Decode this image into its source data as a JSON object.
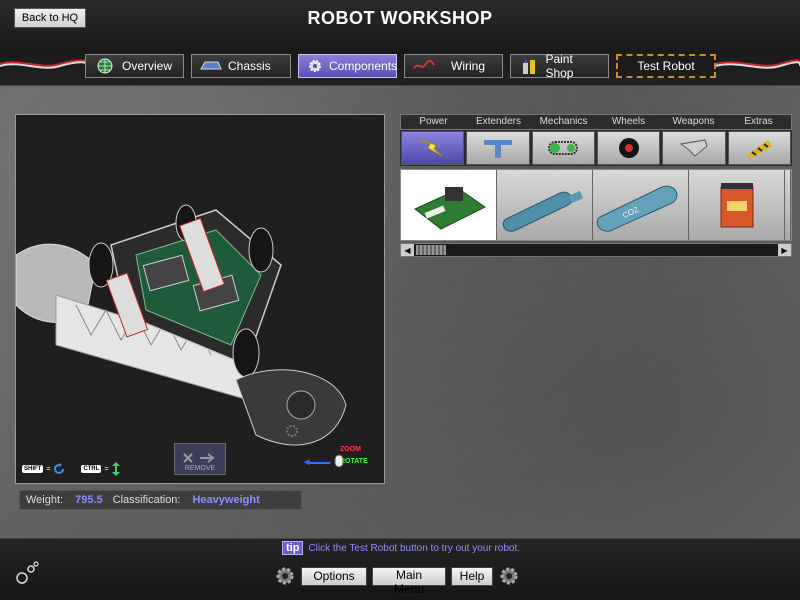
{
  "header": {
    "back_label": "Back to HQ",
    "title": "ROBOT WORKSHOP"
  },
  "tabs": [
    {
      "label": "Overview",
      "icon": "globe-icon"
    },
    {
      "label": "Chassis",
      "icon": "chassis-icon"
    },
    {
      "label": "Components",
      "icon": "gear-icon",
      "active": true
    },
    {
      "label": "Wiring",
      "icon": "wire-icon"
    },
    {
      "label": "Paint Shop",
      "icon": "paint-icon"
    },
    {
      "label": "Test Robot",
      "icon": ""
    }
  ],
  "viewport": {
    "shift_key": "SHIFT",
    "ctrl_key": "CTRL",
    "remove_label": "REMOVE",
    "zoom_label": "ZOOM",
    "rotate_label": "ROTATE"
  },
  "stats": {
    "weight_label": "Weight:",
    "weight_value": "795.5",
    "class_label": "Classification:",
    "class_value": "Heavyweight"
  },
  "categories": [
    {
      "label": "Power",
      "icon": "lightning-icon",
      "active": true
    },
    {
      "label": "Extenders",
      "icon": "extender-icon"
    },
    {
      "label": "Mechanics",
      "icon": "chain-icon"
    },
    {
      "label": "Wheels",
      "icon": "wheel-icon"
    },
    {
      "label": "Weapons",
      "icon": "blade-icon"
    },
    {
      "label": "Extras",
      "icon": "hazard-icon"
    }
  ],
  "parts": [
    {
      "name": "circuit-board"
    },
    {
      "name": "pneumatic-tank-blue"
    },
    {
      "name": "co2-tank"
    },
    {
      "name": "battery-box"
    }
  ],
  "footer": {
    "tip_badge": "tip",
    "tip_text": "Click the Test Robot button to try out your robot.",
    "options_label": "Options",
    "main_menu_label": "Main Menu",
    "help_label": "Help"
  },
  "colors": {
    "accent": "#6a5fd0",
    "value_text": "#8f8cff",
    "test_border": "#d08a2a"
  }
}
